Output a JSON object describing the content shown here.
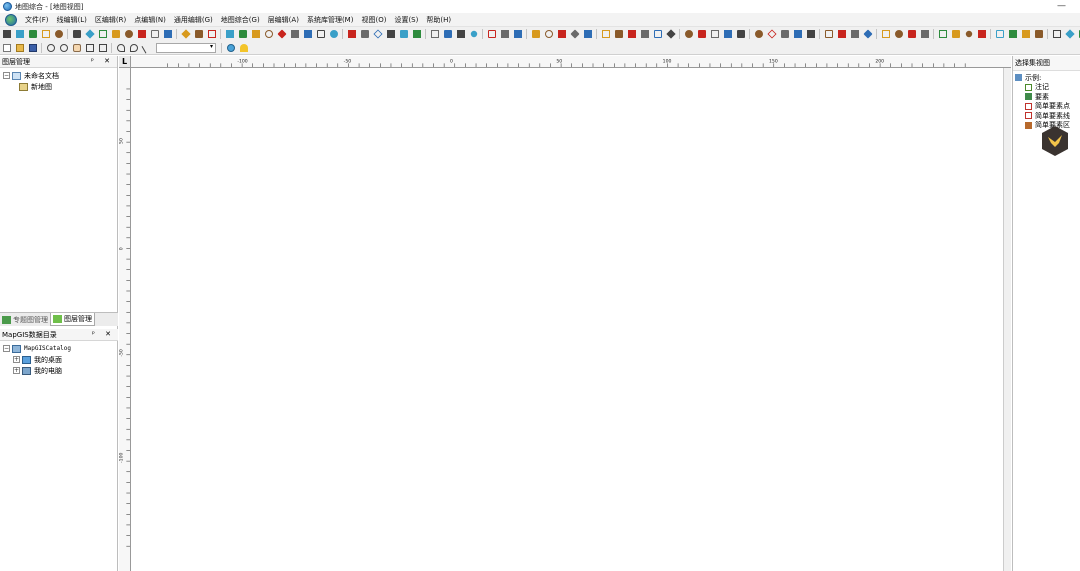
{
  "window": {
    "title": "地图综合 - [地图视图]",
    "minimize": "—"
  },
  "menu": [
    "文件(F)",
    "线编辑(L)",
    "区编辑(R)",
    "点编辑(N)",
    "通用编辑(G)",
    "地图综合(G)",
    "层编辑(A)",
    "系统库管理(M)",
    "视图(O)",
    "设置(S)",
    "帮助(H)"
  ],
  "layer_panel": {
    "title": "图层管理",
    "buttons": "ᵖ ✕",
    "tree": [
      {
        "label": "未命名文档",
        "icon": "document-icon",
        "level": 0
      },
      {
        "label": "新地图",
        "icon": "map-icon",
        "level": 1
      }
    ],
    "tabs": [
      {
        "label": "专题图管理",
        "active": false
      },
      {
        "label": "图层管理",
        "active": true
      }
    ]
  },
  "catalog_panel": {
    "title": "MapGIS数据目录",
    "buttons": "ᵖ ✕",
    "tree": [
      {
        "label": "MapGISCatalog",
        "icon": "catalog-icon",
        "level": 0
      },
      {
        "label": "我的桌面",
        "icon": "desktop-icon",
        "level": 1
      },
      {
        "label": "我的电脑",
        "icon": "computer-icon",
        "level": 1
      }
    ]
  },
  "map": {
    "corner": "L",
    "hruler_labels": [
      "-100",
      "-50",
      "0",
      "50",
      "100",
      "150",
      "200"
    ],
    "vruler_labels": [
      "50",
      "0",
      "-50",
      "-100"
    ]
  },
  "select_panel": {
    "title": "选择集视图",
    "tree": [
      {
        "label": "示例:",
        "icon": "sample-icon",
        "level": 0
      },
      {
        "label": "注记",
        "icon": "annotation-icon",
        "level": 1
      },
      {
        "label": "要素",
        "icon": "feature-icon",
        "level": 1
      },
      {
        "label": "简单要素点",
        "icon": "point-feature-icon",
        "level": 1
      },
      {
        "label": "简单要素线",
        "icon": "line-feature-icon",
        "level": 1
      },
      {
        "label": "简单要素区",
        "icon": "area-feature-icon",
        "level": 1
      }
    ]
  },
  "colors": {
    "toolbar_bg": "#f0f0f0",
    "accent_green": "#2e8b3d",
    "accent_red": "#c8251e",
    "badge": "#3a3330",
    "badge_bird": "#f3c44a"
  }
}
